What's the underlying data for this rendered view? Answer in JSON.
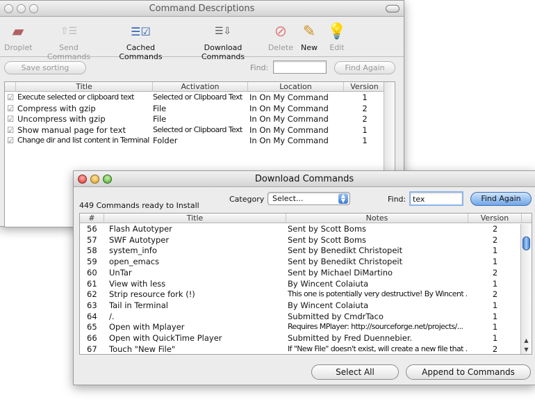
{
  "back_window": {
    "title": "Command Descriptions",
    "toolbar": [
      {
        "label": "Droplet",
        "icon": "droplet-icon",
        "enabled": false
      },
      {
        "label": "Send Commands",
        "icon": "send-commands-icon",
        "enabled": false
      },
      {
        "label": "Cached Commands",
        "icon": "cached-commands-icon",
        "enabled": true
      },
      {
        "label": "Download Commands",
        "icon": "download-commands-icon",
        "enabled": true
      },
      {
        "label": "Delete",
        "icon": "delete-icon",
        "enabled": false
      },
      {
        "label": "New",
        "icon": "pencil-icon",
        "enabled": true
      },
      {
        "label": "Edit",
        "icon": "lightbulb-icon",
        "enabled": false
      }
    ],
    "save_sorting": "Save sorting",
    "find_label": "Find:",
    "find_value": "",
    "find_again": "Find Again",
    "columns": [
      "Title",
      "Activation",
      "Location",
      "Version"
    ],
    "rows": [
      {
        "checked": true,
        "title": "Execute selected or clipboard text",
        "activation": "Selected or Clipboard Text",
        "location": "In On My Command",
        "version": "1"
      },
      {
        "checked": true,
        "title": "Compress with gzip",
        "activation": "File",
        "location": "In On My Command",
        "version": "2"
      },
      {
        "checked": true,
        "title": "Uncompress with gzip",
        "activation": "File",
        "location": "In On My Command",
        "version": "2"
      },
      {
        "checked": true,
        "title": "Show manual page for text",
        "activation": "Selected or Clipboard Text",
        "location": "In On My Command",
        "version": "1"
      },
      {
        "checked": true,
        "title": "Change dir and list content in Terminal",
        "activation": "Folder",
        "location": "In On My Command",
        "version": "1"
      }
    ]
  },
  "front_window": {
    "title": "Download Commands",
    "status": "449 Commands ready to Install",
    "category_label": "Category",
    "category_value": "Select...",
    "find_label": "Find:",
    "find_value": "tex",
    "find_again": "Find Again",
    "columns": [
      "#",
      "Title",
      "Notes",
      "Version"
    ],
    "rows": [
      {
        "num": "56",
        "title": "Flash Autotyper",
        "notes": "Sent by Scott Boms",
        "version": "2"
      },
      {
        "num": "57",
        "title": "SWF Autotyper",
        "notes": "Sent by Scott Boms",
        "version": "2"
      },
      {
        "num": "58",
        "title": "system_info",
        "notes": "Sent by Benedikt Christopeit",
        "version": "1"
      },
      {
        "num": "59",
        "title": "open_emacs",
        "notes": "Sent by Benedikt Christopeit",
        "version": "1"
      },
      {
        "num": "60",
        "title": "UnTar",
        "notes": "Sent by Michael DiMartino",
        "version": "2"
      },
      {
        "num": "61",
        "title": "View with less",
        "notes": "By Wincent Colaiuta",
        "version": "1"
      },
      {
        "num": "62",
        "title": "Strip resource fork (!)",
        "notes": "This one is potentially very destructive! By Wincent ...",
        "version": "2"
      },
      {
        "num": "63",
        "title": "Tail in Terminal",
        "notes": "By Wincent Colaiuta",
        "version": "1"
      },
      {
        "num": "64",
        "title": "/.",
        "notes": "Submitted by CmdrTaco",
        "version": "1"
      },
      {
        "num": "65",
        "title": "Open with Mplayer",
        "notes": "Requires MPlayer: http://sourceforge.net/projects/...",
        "version": "1"
      },
      {
        "num": "66",
        "title": "Open with QuickTime Player",
        "notes": "Submitted by Fred Duennebier.",
        "version": "1"
      },
      {
        "num": "67",
        "title": "Touch \"New File\"",
        "notes": "If \"New File\" doesn't exist, will create a new file that ...",
        "version": "2"
      }
    ],
    "select_all": "Select All",
    "append": "Append to Commands"
  }
}
